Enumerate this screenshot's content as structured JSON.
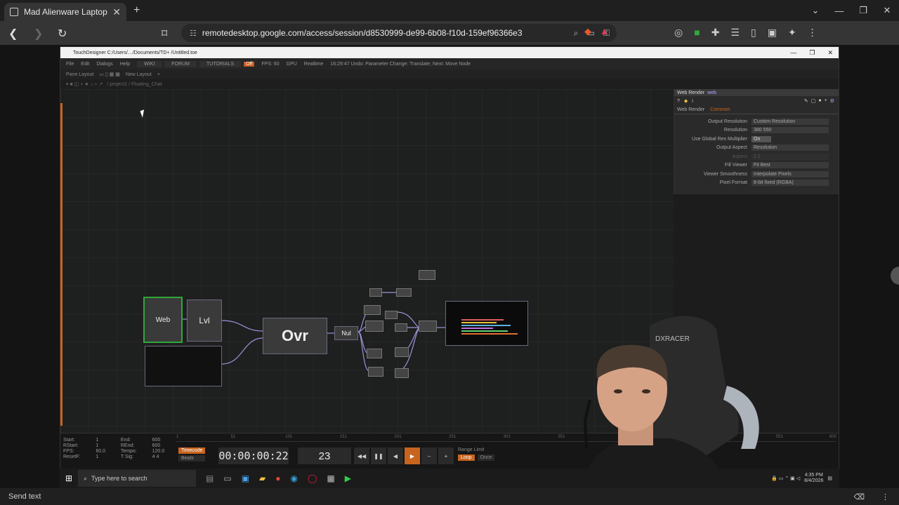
{
  "browser": {
    "tab_title": "Mad Alienware Laptop",
    "new_tab": "+",
    "url": "remotedesktop.google.com/access/session/d8530999-de99-6b08-f10d-159ef96366e3",
    "window_controls": [
      "⌄",
      "—",
      "❐",
      "✕"
    ]
  },
  "td": {
    "title": "TouchDesigner  C:/Users/…/Documents/TD+ /Untitled.toe",
    "menu": [
      "File",
      "Edit",
      "Dialogs",
      "Help"
    ],
    "menu_tabs": [
      "WIKI",
      "FORUM",
      "TUTORIALS"
    ],
    "fps_label": "FPS: 60",
    "gpu_label": "GPU",
    "realtime_label": "Realtime",
    "status_text": "16:29:47 Undo: Parameter Change: Translate; Next: Move Node",
    "pane_layout": "Pane Layout",
    "new_layout": "New Layout",
    "path": "/ project1 / Floating_Chat"
  },
  "nodes": {
    "web": "Web",
    "lvl": "Lvl",
    "ovr": "Ovr",
    "nul": "Nul"
  },
  "params": {
    "op_type": "Web Render",
    "op_name": "web",
    "tabs": [
      "Web Render",
      "Common"
    ],
    "rows": [
      {
        "label": "Output Resolution",
        "value": "Custom Resolution"
      },
      {
        "label": "Resolution",
        "value": "380        550"
      },
      {
        "label": "Use Global Res Multiplier",
        "value": "On"
      },
      {
        "label": "Output Aspect",
        "value": "Resolution"
      },
      {
        "label": "Aspect",
        "value": "1        1"
      },
      {
        "label": "Fill Viewer",
        "value": "Fit Best"
      },
      {
        "label": "Viewer Smoothness",
        "value": "Interpolate Pixels"
      },
      {
        "label": "Pixel Format",
        "value": "8-bit fixed (RGBA)"
      }
    ]
  },
  "timeline": {
    "info": [
      {
        "k": "Start:",
        "v": "1",
        "k2": "End:",
        "v2": "600"
      },
      {
        "k": "RStart:",
        "v": "1",
        "k2": "REnd:",
        "v2": "600"
      },
      {
        "k": "FPS:",
        "v": "60.0",
        "k2": "Tempo:",
        "v2": "120.0"
      },
      {
        "k": "ResetF:",
        "v": "1",
        "k2": "T Sig:",
        "v2": "4    4"
      }
    ],
    "tc_tab": "Timecode",
    "beats_tab": "Beats",
    "timecode": "00:00:00:22",
    "frame": "23",
    "range_limit": "Range Limit",
    "loop": "Loop",
    "once": "Once",
    "ruler_ticks": [
      "1",
      "51",
      "101",
      "151",
      "201",
      "251",
      "301",
      "351",
      "551",
      "600"
    ]
  },
  "taskbar": {
    "search_placeholder": "Type here to search",
    "time": "4:35 PM",
    "date": "8/4/2026"
  },
  "sendbar": {
    "label": "Send text"
  }
}
